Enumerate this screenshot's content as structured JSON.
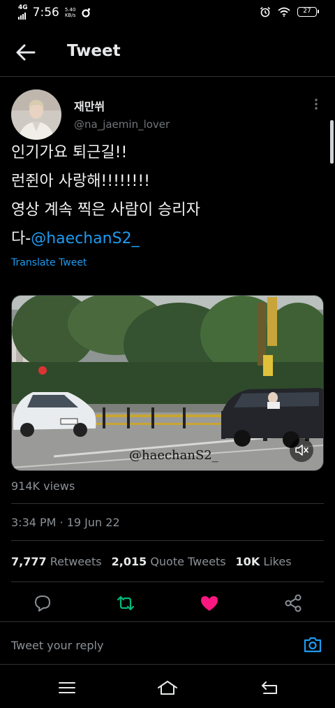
{
  "status_bar": {
    "network": "4G",
    "time": "7:56",
    "speed_value": "5.40",
    "speed_unit": "KB/s",
    "battery": "27",
    "icons": [
      "signal-icon",
      "alarm-icon",
      "wifi-icon",
      "battery-icon"
    ]
  },
  "header": {
    "title": "Tweet",
    "back_icon": "arrow-left-icon"
  },
  "tweet": {
    "author_name": "재만쒸",
    "author_handle": "@na_jaemin_lover",
    "lines": [
      "인기가요 퇴근길!!",
      "런쥔아 사랑해!!!!!!!!",
      "영상 계속 찍은 사람이 승리자",
      "다-"
    ],
    "mention": "@haechanS2_",
    "translate_label": "Translate Tweet",
    "media_watermark": "@haechanS2_",
    "views": "914K views",
    "timestamp": "3:34 PM · 19 Jun 22",
    "retweets_count": "7,777",
    "retweets_label": "Retweets",
    "quotes_count": "2,015",
    "quotes_label": "Quote Tweets",
    "likes_count": "10K",
    "likes_label": "Likes",
    "liked": true
  },
  "actions": {
    "reply_icon": "reply-icon",
    "retweet_icon": "retweet-icon",
    "like_icon": "heart-icon",
    "share_icon": "share-icon"
  },
  "reply": {
    "placeholder": "Tweet your reply"
  },
  "colors": {
    "background": "#000000",
    "accent": "#1d9bf0",
    "retweet": "#00ba7c",
    "like": "#f91880",
    "secondary_text": "#71767b"
  },
  "navbar": {
    "icons": [
      "menu-icon",
      "home-icon",
      "back-icon"
    ]
  }
}
